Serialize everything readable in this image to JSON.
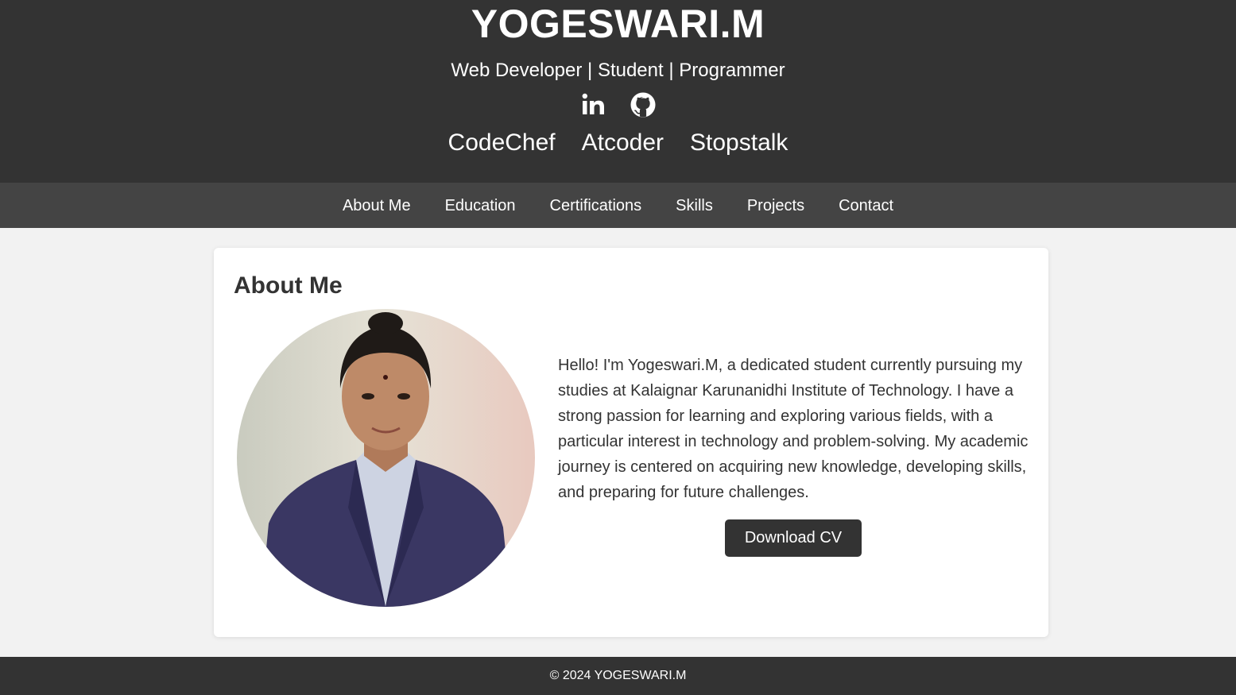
{
  "header": {
    "title": "YOGESWARI.M",
    "tagline": "Web Developer | Student | Programmer",
    "social_icons": [
      {
        "name": "linkedin-icon"
      },
      {
        "name": "github-icon"
      }
    ],
    "profile_links": [
      "CodeChef",
      "Atcoder",
      "Stopstalk"
    ]
  },
  "nav": {
    "items": [
      "About Me",
      "Education",
      "Certifications",
      "Skills",
      "Projects",
      "Contact"
    ]
  },
  "about": {
    "heading": "About Me",
    "text": "Hello! I'm Yogeswari.M, a dedicated student currently pursuing my studies at Kalaignar Karunanidhi Institute of Technology. I have a strong passion for learning and exploring various fields, with a particular interest in technology and problem-solving. My academic journey is centered on acquiring new knowledge, developing skills, and preparing for future challenges.",
    "download_label": "Download CV"
  },
  "footer": {
    "copyright": "© 2024 YOGESWARI.M"
  },
  "colors": {
    "header_bg": "#333333",
    "nav_bg": "#444444",
    "page_bg": "#f2f2f2",
    "card_bg": "#ffffff",
    "button_bg": "#333333",
    "text": "#333333"
  }
}
